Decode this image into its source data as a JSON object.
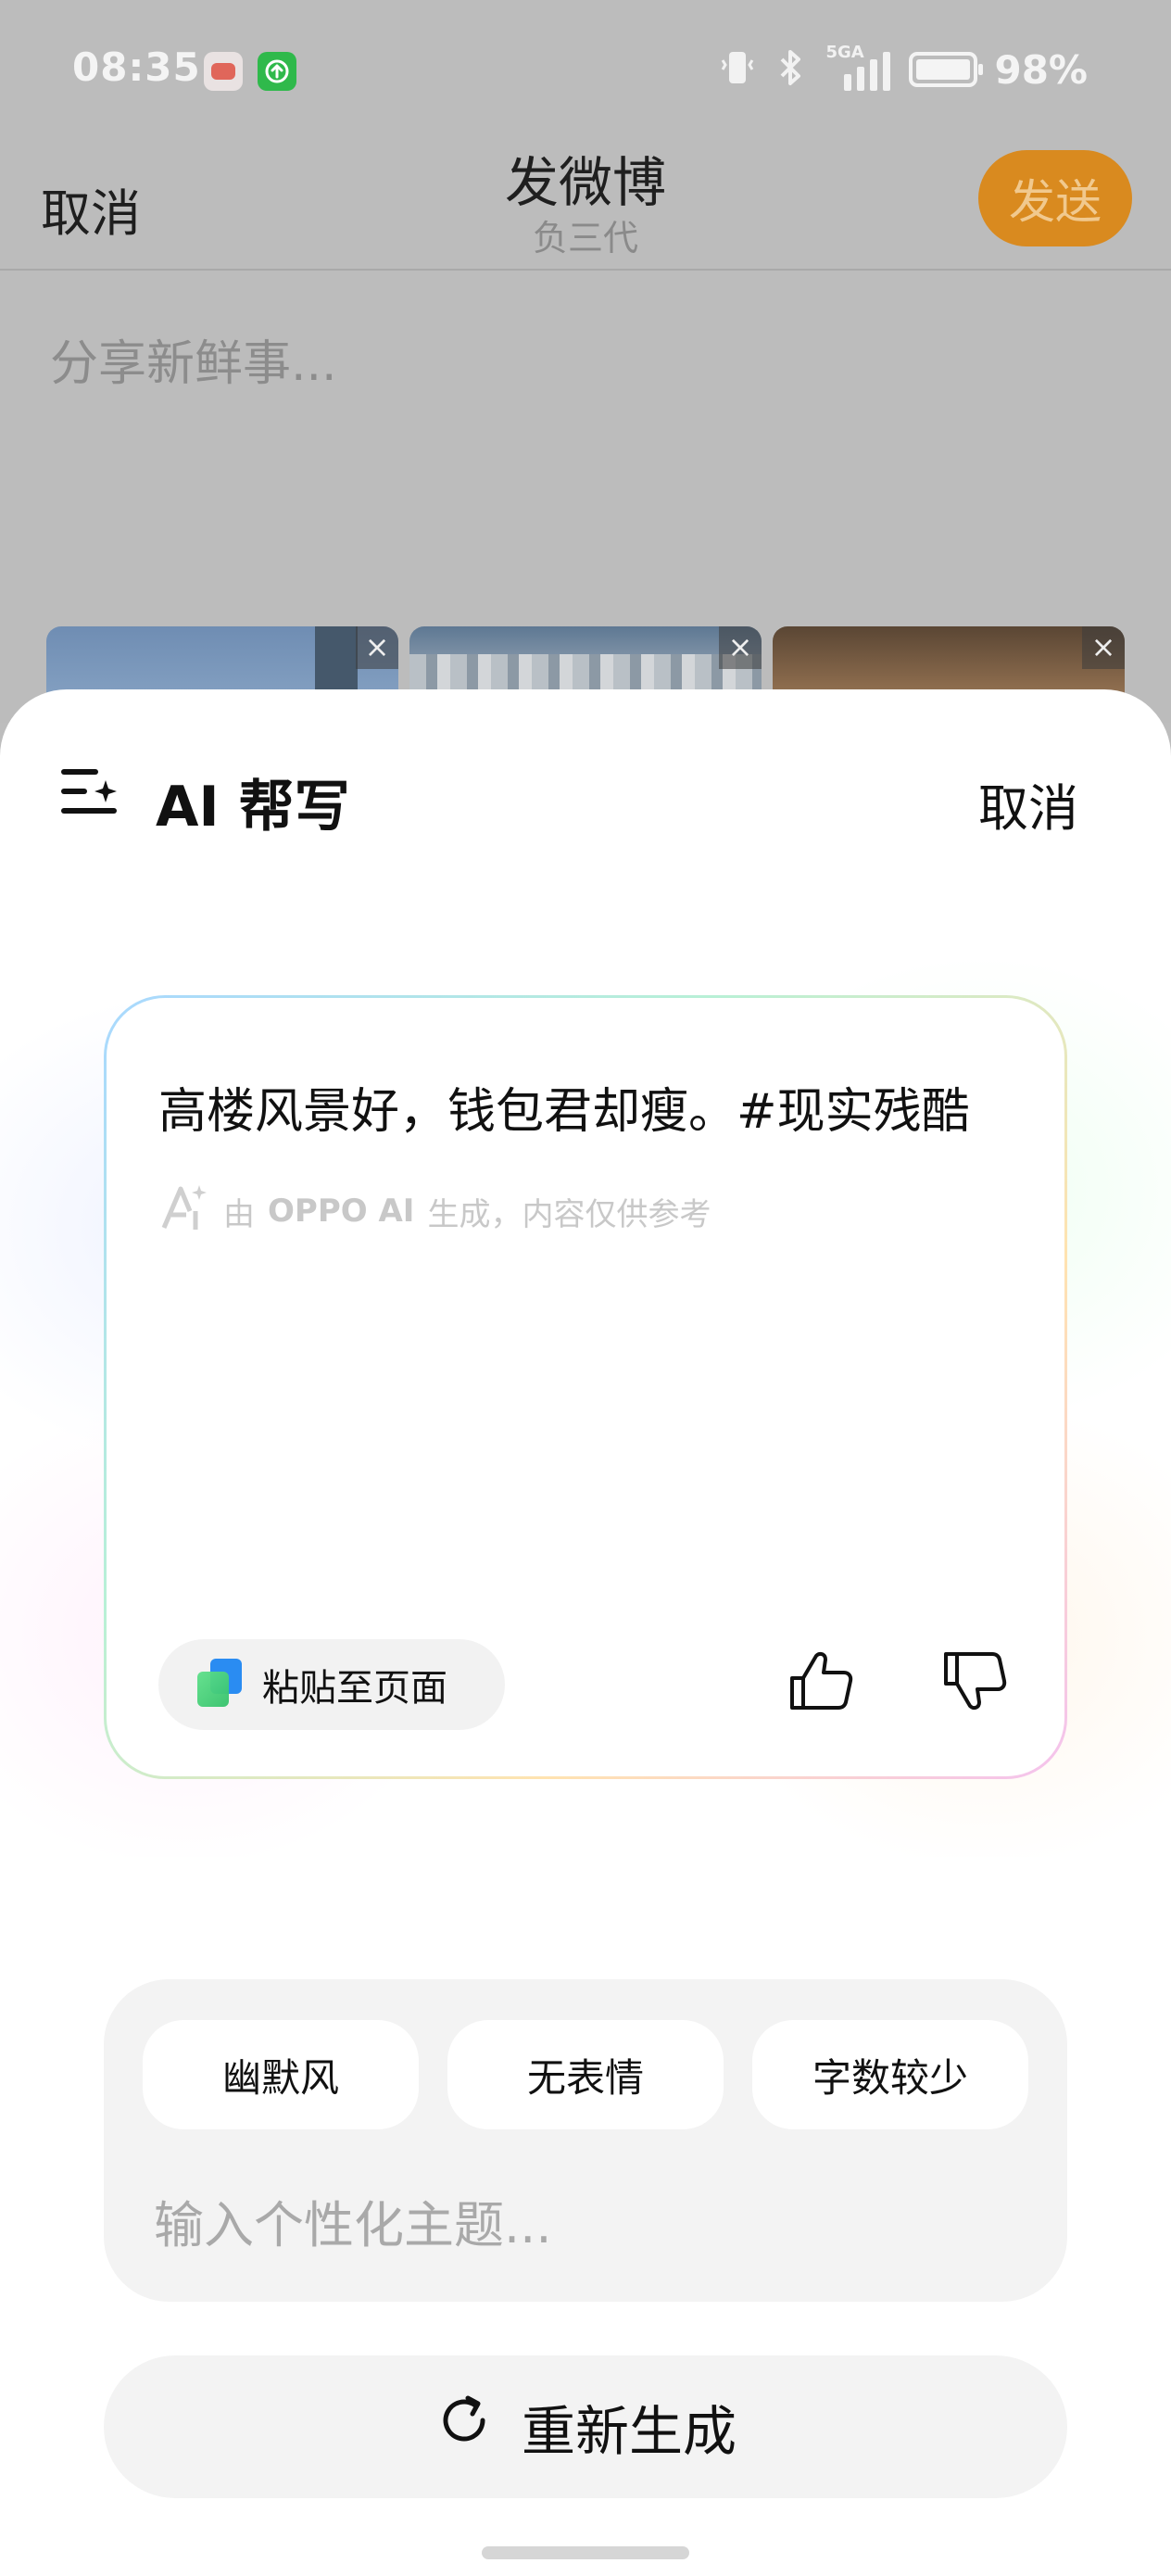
{
  "status_bar": {
    "time": "08:35",
    "network": "5GA",
    "battery": "98%"
  },
  "nav": {
    "cancel": "取消",
    "title": "发微博",
    "subtitle": "负三代",
    "send": "发送"
  },
  "compose": {
    "placeholder": "分享新鲜事..."
  },
  "sheet": {
    "title": "AI 帮写",
    "cancel": "取消",
    "result_text": "高楼风景好，钱包君却瘦。#现实残酷",
    "ai_note_prefix": "由",
    "ai_note_brand": "OPPO AI",
    "ai_note_suffix": "生成，内容仅供参考",
    "paste_label": "粘贴至页面",
    "chips": [
      "幽默风",
      "无表情",
      "字数较少"
    ],
    "topic_placeholder": "输入个性化主题...",
    "regenerate": "重新生成"
  },
  "colors": {
    "accent": "#d98a1f",
    "dim_bg": "#bcbcbc",
    "sheet_bg": "#ffffff",
    "chip_area": "#f3f3f3"
  }
}
